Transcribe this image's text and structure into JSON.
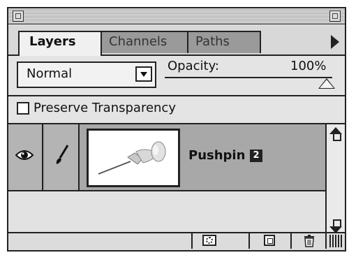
{
  "tabs": [
    {
      "label": "Layers"
    },
    {
      "label": "Channels"
    },
    {
      "label": "Paths"
    }
  ],
  "blend": {
    "mode": "Normal"
  },
  "opacity": {
    "label": "Opacity:",
    "value": "100%"
  },
  "preserve": {
    "label": "Preserve Transparency",
    "checked": false
  },
  "layers": [
    {
      "name": "Pushpin",
      "badge": "2",
      "visible": true,
      "icon": "pushpin-thumbnail"
    }
  ]
}
